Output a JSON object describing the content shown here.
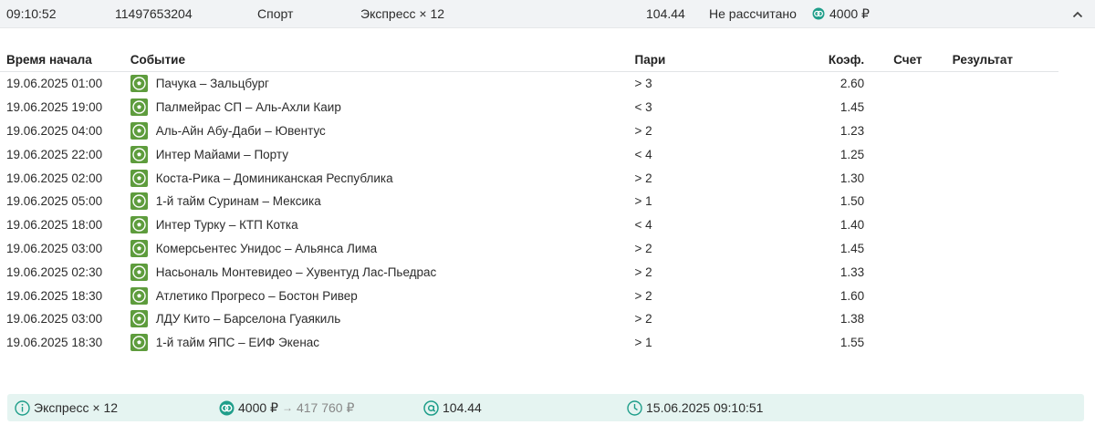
{
  "header": {
    "time": "09:10:52",
    "bet_id": "11497653204",
    "sport": "Спорт",
    "type": "Экспресс × 12",
    "odds": "104.44",
    "status": "Не рассчитано",
    "stake": "4000 ₽",
    "collapse_icon": "chevron-up-icon"
  },
  "table": {
    "columns": [
      "Время начала",
      "Событие",
      "Пари",
      "Коэф.",
      "Счет",
      "Результат"
    ],
    "rows": [
      {
        "time": "19.06.2025 01:00",
        "event": "Пачука – Зальцбург",
        "bet": "> 3",
        "coef": "2.60"
      },
      {
        "time": "19.06.2025 19:00",
        "event": "Палмейрас СП – Аль-Ахли Каир",
        "bet": "< 3",
        "coef": "1.45"
      },
      {
        "time": "19.06.2025 04:00",
        "event": "Аль-Айн Абу-Даби – Ювентус",
        "bet": "> 2",
        "coef": "1.23"
      },
      {
        "time": "19.06.2025 22:00",
        "event": "Интер Майами – Порту",
        "bet": "< 4",
        "coef": "1.25"
      },
      {
        "time": "19.06.2025 02:00",
        "event": "Коста-Рика – Доминиканская Республика",
        "bet": "> 2",
        "coef": "1.30"
      },
      {
        "time": "19.06.2025 05:00",
        "event": "1-й тайм Суринам – Мексика",
        "bet": "> 1",
        "coef": "1.50"
      },
      {
        "time": "19.06.2025 18:00",
        "event": "Интер Турку – КТП Котка",
        "bet": "< 4",
        "coef": "1.40"
      },
      {
        "time": "19.06.2025 03:00",
        "event": "Комерсьентес Унидос – Альянса Лима",
        "bet": "> 2",
        "coef": "1.45"
      },
      {
        "time": "19.06.2025 02:30",
        "event": "Насьональ Монтевидео – Хувентуд Лас-Пьедрас",
        "bet": "> 2",
        "coef": "1.33"
      },
      {
        "time": "19.06.2025 18:30",
        "event": "Атлетико Прогресо – Бостон Ривер",
        "bet": "> 2",
        "coef": "1.60"
      },
      {
        "time": "19.06.2025 03:00",
        "event": "ЛДУ Кито – Барселона Гуаякиль",
        "bet": "> 2",
        "coef": "1.38"
      },
      {
        "time": "19.06.2025 18:30",
        "event": "1-й тайм ЯПС – ЕИФ Экенас",
        "bet": "> 1",
        "coef": "1.55"
      }
    ]
  },
  "footer": {
    "type": "Экспресс × 12",
    "stake": "4000 ₽",
    "potential_win": "417 760 ₽",
    "odds": "104.44",
    "date": "15.06.2025 09:10:51"
  },
  "colors": {
    "sport_icon_bg": "#5e9c3d",
    "footer_bg": "#e5f4f1",
    "accent": "#1f9e8a"
  }
}
